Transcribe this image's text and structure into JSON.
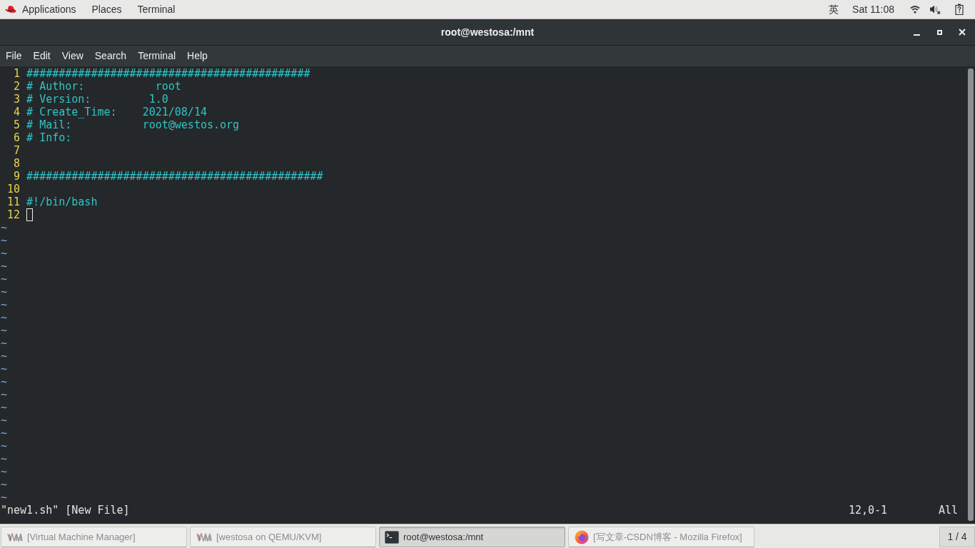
{
  "top_bar": {
    "menus": [
      "Applications",
      "Places",
      "Terminal"
    ],
    "input_method": "英",
    "clock": "Sat 11:08"
  },
  "window": {
    "title": "root@westosa:/mnt"
  },
  "menu_bar": [
    "File",
    "Edit",
    "View",
    "Search",
    "Terminal",
    "Help"
  ],
  "editor": {
    "lines": [
      {
        "number": "1",
        "text": "############################################",
        "cursor": false
      },
      {
        "number": "2",
        "text": "# Author:           root",
        "cursor": false
      },
      {
        "number": "3",
        "text": "# Version:         1.0",
        "cursor": false
      },
      {
        "number": "4",
        "text": "# Create_Time:    2021/08/14",
        "cursor": false
      },
      {
        "number": "5",
        "text": "# Mail:           root@westos.org",
        "cursor": false
      },
      {
        "number": "6",
        "text": "# Info:",
        "cursor": false
      },
      {
        "number": "7",
        "cursor": false
      },
      {
        "number": "8",
        "cursor": false
      },
      {
        "number": "9",
        "text": "##############################################",
        "cursor": false
      },
      {
        "number": "10",
        "cursor": false
      },
      {
        "number": "11",
        "text": "#!/bin/bash",
        "cursor": false
      },
      {
        "number": "12",
        "cursor": true
      }
    ],
    "filler_lines": [
      "~",
      "~",
      "~",
      "~",
      "~",
      "~",
      "~",
      "~",
      "~",
      "~",
      "~",
      "~",
      "~",
      "~",
      "~",
      "~",
      "~",
      "~",
      "~",
      "~",
      "~",
      "~"
    ],
    "status_line": {
      "message": "\"new1.sh\" [New File]",
      "position": "12,0-1",
      "scroll": "All"
    }
  },
  "taskbar": {
    "items": [
      {
        "label": "[Virtual Machine Manager]",
        "kind": "vm",
        "selected": false
      },
      {
        "label": "[westosa on QEMU/KVM]",
        "kind": "vm",
        "selected": false
      },
      {
        "label": "root@westosa:/mnt",
        "kind": "terminal",
        "selected": true
      },
      {
        "label": "[写文章-CSDN博客 - Mozilla Firefox]",
        "kind": "browser",
        "selected": false
      }
    ],
    "pager": "1 / 4"
  }
}
